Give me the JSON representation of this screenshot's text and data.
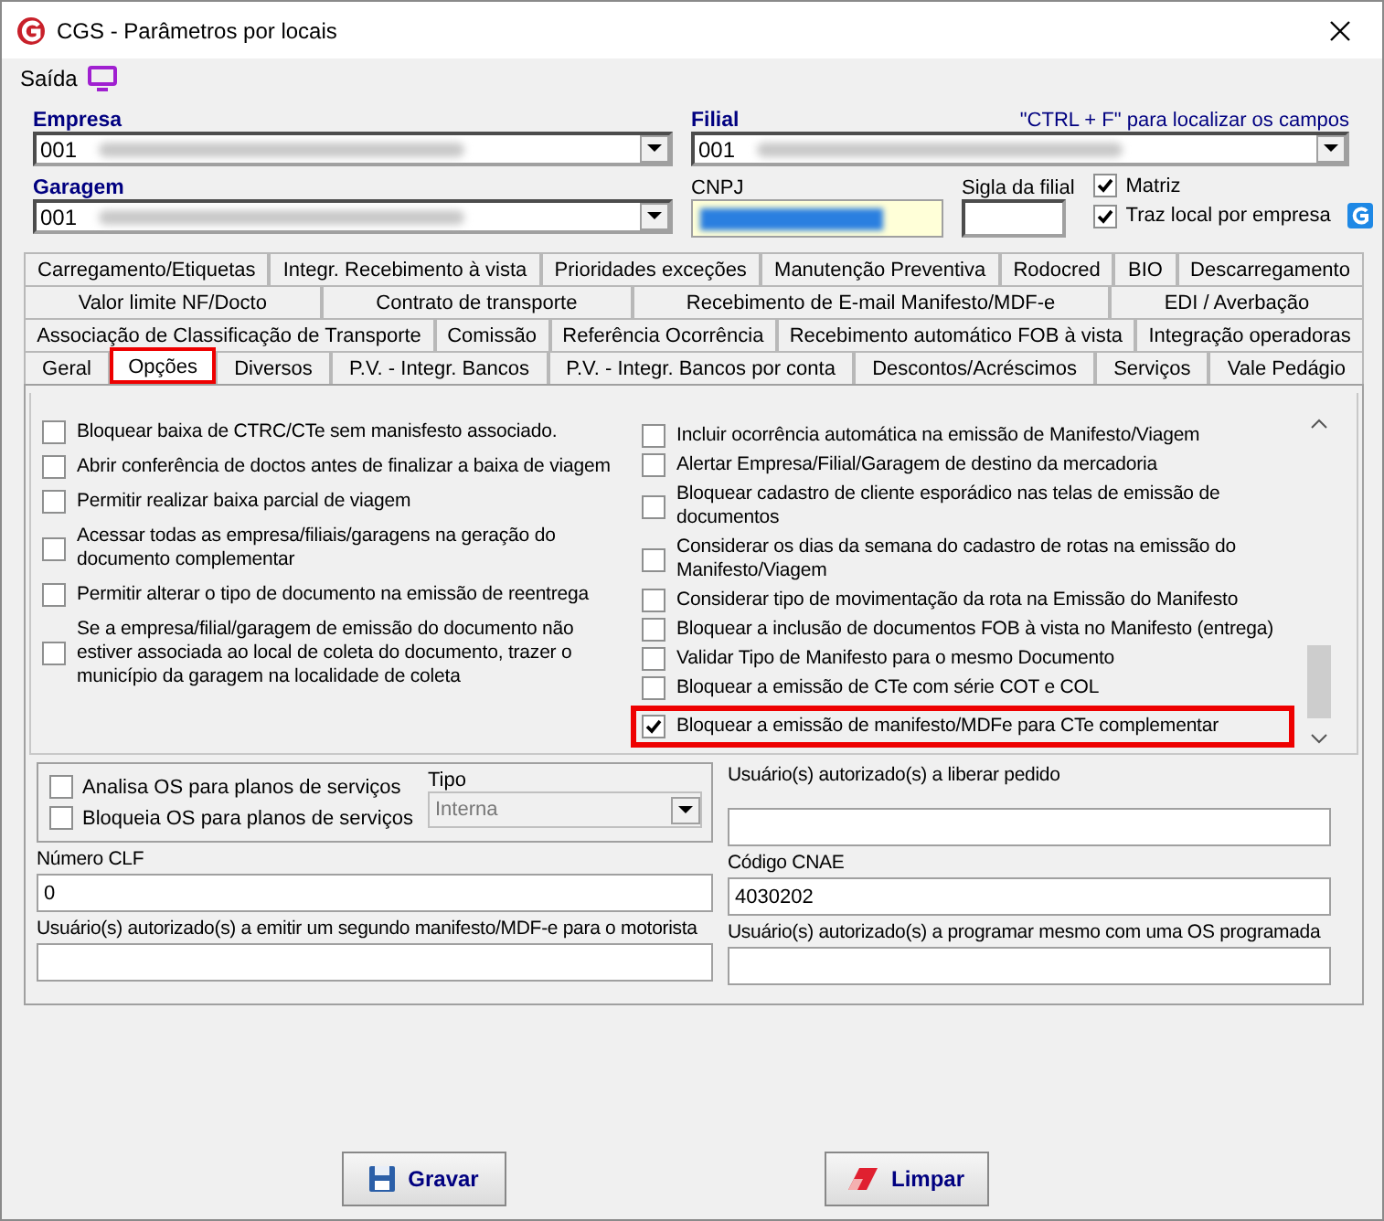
{
  "window": {
    "title": "CGS - Parâmetros por locais"
  },
  "menu": [
    {
      "label": "Saída"
    }
  ],
  "header": {
    "empresa": {
      "label": "Empresa",
      "value": "001",
      "redacted": true
    },
    "filial": {
      "label": "Filial",
      "value": "001",
      "redacted": true
    },
    "hint": "\"CTRL + F\" para localizar os campos",
    "garagem": {
      "label": "Garagem",
      "value": "001",
      "redacted": true
    },
    "cnpj": {
      "label": "CNPJ",
      "redacted": true
    },
    "sigla": {
      "label": "Sigla da filial"
    },
    "checks": [
      {
        "label": "Matriz",
        "checked": true
      },
      {
        "label": "Traz local por empresa",
        "checked": true
      }
    ]
  },
  "tab_rows": [
    [
      {
        "label": "Carregamento/Etiquetas",
        "selected": false,
        "highlighted": false
      },
      {
        "label": "Integr. Recebimento à vista",
        "selected": false,
        "highlighted": false
      },
      {
        "label": "Prioridades exceções",
        "selected": false,
        "highlighted": false
      },
      {
        "label": "Manutenção Preventiva",
        "selected": false,
        "highlighted": false
      },
      {
        "label": "Rodocred",
        "selected": false,
        "highlighted": false
      },
      {
        "label": "BIO",
        "selected": false,
        "highlighted": false
      },
      {
        "label": "Descarregamento",
        "selected": false,
        "highlighted": false
      }
    ],
    [
      {
        "label": "Valor limite NF/Docto",
        "selected": false,
        "highlighted": false
      },
      {
        "label": "Contrato de transporte",
        "selected": false,
        "highlighted": false
      },
      {
        "label": "Recebimento de E-mail Manifesto/MDF-e",
        "selected": false,
        "highlighted": false
      },
      {
        "label": "EDI / Averbação",
        "selected": false,
        "highlighted": false
      }
    ],
    [
      {
        "label": "Associação de Classificação de Transporte",
        "selected": false,
        "highlighted": false
      },
      {
        "label": "Comissão",
        "selected": false,
        "highlighted": false
      },
      {
        "label": "Referência Ocorrência",
        "selected": false,
        "highlighted": false
      },
      {
        "label": "Recebimento automático FOB à vista",
        "selected": false,
        "highlighted": false
      },
      {
        "label": "Integração operadoras",
        "selected": false,
        "highlighted": false
      }
    ],
    [
      {
        "label": "Geral",
        "selected": false,
        "highlighted": false
      },
      {
        "label": "Opções",
        "selected": true,
        "highlighted": true
      },
      {
        "label": "Diversos",
        "selected": false,
        "highlighted": false
      },
      {
        "label": "P.V. - Integr. Bancos",
        "selected": false,
        "highlighted": false
      },
      {
        "label": "P.V. - Integr. Bancos por conta",
        "selected": false,
        "highlighted": false
      },
      {
        "label": "Descontos/Acréscimos",
        "selected": false,
        "highlighted": false
      },
      {
        "label": "Serviços",
        "selected": false,
        "highlighted": false
      },
      {
        "label": "Vale Pedágio",
        "selected": false,
        "highlighted": false
      }
    ]
  ],
  "options": {
    "left": [
      {
        "label": "Bloquear baixa de CTRC/CTe sem manisfesto associado.",
        "checked": false,
        "highlighted": false
      },
      {
        "label": "Abrir conferência de doctos antes de finalizar a baixa de viagem",
        "checked": false,
        "highlighted": false
      },
      {
        "label": "Permitir realizar baixa parcial de viagem",
        "checked": false,
        "highlighted": false
      },
      {
        "label": "Acessar todas as empresa/filiais/garagens na geração do documento complementar",
        "checked": false,
        "highlighted": false
      },
      {
        "label": "Permitir alterar o tipo de documento na emissão de reentrega",
        "checked": false,
        "highlighted": false
      },
      {
        "label": "Se a empresa/filial/garagem de emissão do documento não estiver associada ao local de coleta do documento, trazer o município da garagem na localidade de coleta",
        "checked": false,
        "highlighted": false
      }
    ],
    "right": [
      {
        "label": "Incluir ocorrência automática na emissão de Manifesto/Viagem",
        "checked": false,
        "highlighted": false
      },
      {
        "label": "Alertar Empresa/Filial/Garagem de destino da mercadoria",
        "checked": false,
        "highlighted": false
      },
      {
        "label": "Bloquear cadastro de cliente esporádico nas telas de emissão de documentos",
        "checked": false,
        "highlighted": false
      },
      {
        "label": "Considerar os dias da semana do cadastro de rotas na emissão do Manifesto/Viagem",
        "checked": false,
        "highlighted": false
      },
      {
        "label": "Considerar tipo de movimentação da rota na Emissão do Manifesto",
        "checked": false,
        "highlighted": false
      },
      {
        "label": "Bloquear a inclusão de documentos FOB à vista no Manifesto (entrega)",
        "checked": false,
        "highlighted": false
      },
      {
        "label": "Validar Tipo de Manifesto para o mesmo Documento",
        "checked": false,
        "highlighted": false
      },
      {
        "label": "Bloquear a emissão de CTe com série COT e COL",
        "checked": false,
        "highlighted": false
      },
      {
        "label": "Bloquear a emissão de manifesto/MDFe para CTe complementar",
        "checked": true,
        "highlighted": true
      }
    ]
  },
  "os_group": {
    "checks": [
      {
        "label": "Analisa OS para planos de serviços",
        "checked": false
      },
      {
        "label": "Bloqueia OS para planos de serviços",
        "checked": false
      }
    ],
    "tipo": {
      "label": "Tipo",
      "value": "Interna",
      "disabled": true
    }
  },
  "fields": {
    "liberar": {
      "label": "Usuário(s) autorizado(s) a liberar pedido"
    },
    "numero_clf": {
      "label": "Número CLF",
      "value": "0"
    },
    "codigo_cnae": {
      "label": "Código CNAE",
      "value": "4030202"
    },
    "emitir": {
      "label": "Usuário(s) autorizado(s) a emitir um segundo manifesto/MDF-e para o motorista"
    },
    "programar": {
      "label": "Usuário(s) autorizado(s) a programar mesmo com uma OS programada"
    }
  },
  "buttons": [
    {
      "label": "Gravar",
      "kind": "save"
    },
    {
      "label": "Limpar",
      "kind": "clear"
    }
  ]
}
